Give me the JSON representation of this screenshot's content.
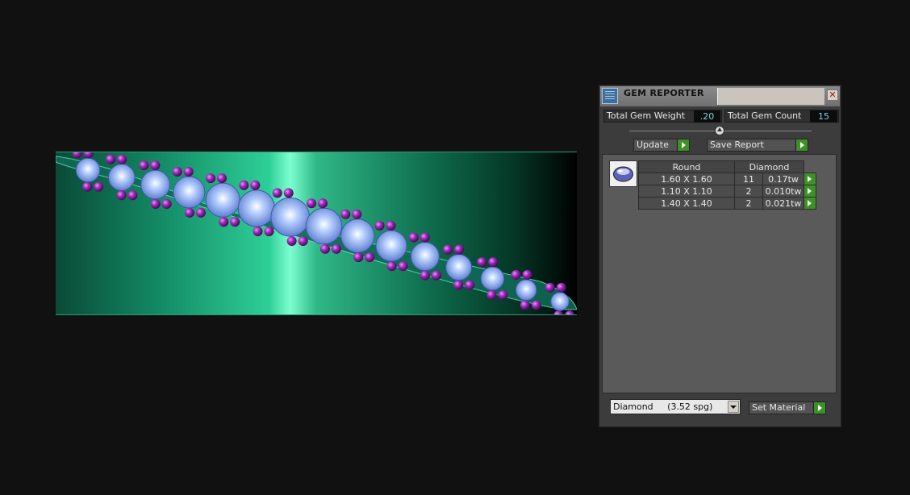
{
  "panel": {
    "title": "GEM REPORTER",
    "close_glyph": "✕",
    "total_weight_label": "Total Gem Weight",
    "total_weight_value": ".20",
    "total_count_label": "Total Gem Count",
    "total_count_value": "15",
    "update_label": "Update",
    "save_report_label": "Save Report",
    "table": {
      "header_shape": "Round",
      "header_material": "Diamond",
      "rows": [
        {
          "size": "1.60 X 1.60",
          "count": "11",
          "weight": "0.17tw"
        },
        {
          "size": "1.10 X 1.10",
          "count": "2",
          "weight": "0.010tw"
        },
        {
          "size": "1.40 X 1.40",
          "count": "2",
          "weight": "0.021tw"
        }
      ]
    },
    "material_value": "Diamond     (3.52 spg)",
    "set_material_label": "Set Material"
  },
  "colors": {
    "band_accent": "#2fcf98",
    "stone": "#8fb6ff",
    "accent_stone": "#9a1fb5",
    "go_button": "#3f8f2a"
  }
}
